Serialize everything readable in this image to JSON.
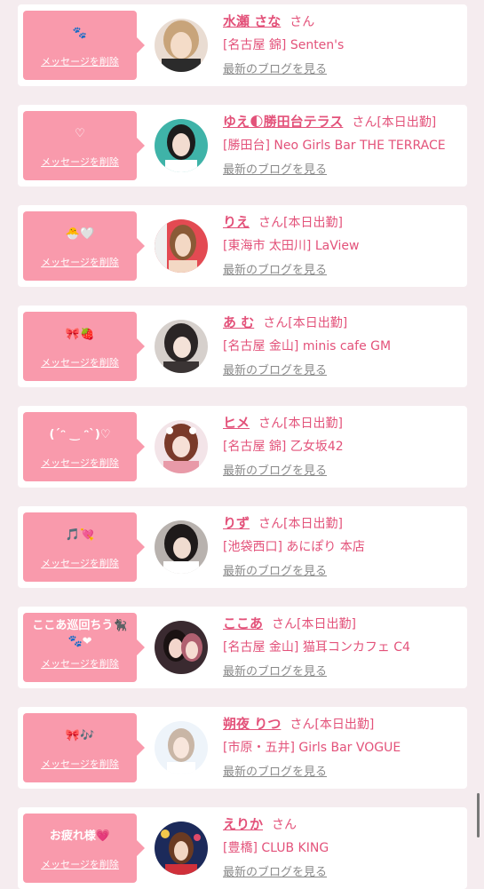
{
  "delete_label": "メッセージを削除",
  "honorific": "さん",
  "blog_link_label": "最新のブログを見る",
  "colors": {
    "bubble": "#f99aac",
    "accent": "#e3527a",
    "link_gray": "#8a8a8a",
    "background": "#f5ecef"
  },
  "entries": [
    {
      "message": "🐾",
      "name": "水瀬 さな",
      "status": "",
      "shop": "[名古屋 錦] Senten's"
    },
    {
      "message": "♡",
      "name": "ゆえ🌓勝田台テラス",
      "status": "[本日出勤]",
      "shop": "[勝田台] Neo Girls Bar THE TERRACE"
    },
    {
      "message": "🐣🤍",
      "name": "りえ",
      "status": "[本日出勤]",
      "shop": "[東海市 太田川] LaView"
    },
    {
      "message": "🎀🍓",
      "name": "あ む",
      "status": "[本日出勤]",
      "shop": "[名古屋 金山] minis cafe GM"
    },
    {
      "message": "(ˊᵔ ‿ ᵔˋ)♡",
      "name": "ヒメ",
      "status": "[本日出勤]",
      "shop": "[名古屋 錦] 乙女坂42"
    },
    {
      "message": "🎵💘",
      "name": "りず",
      "status": "[本日出勤]",
      "shop": "[池袋西口] あにぽり 本店"
    },
    {
      "message": "ここあ巡回ちう🐈‍⬛",
      "message2": "🐾❤",
      "name": "ここあ",
      "status": "[本日出勤]",
      "shop": "[名古屋 金山] 猫耳コンカフェ C4"
    },
    {
      "message": "🎀🎶",
      "name": "朔夜 りつ",
      "status": "[本日出勤]",
      "shop": "[市原・五井] Girls Bar VOGUE"
    },
    {
      "message": "お疲れ様💗",
      "name": "えりか",
      "status": "",
      "shop": "[豊橋] CLUB KING"
    }
  ]
}
